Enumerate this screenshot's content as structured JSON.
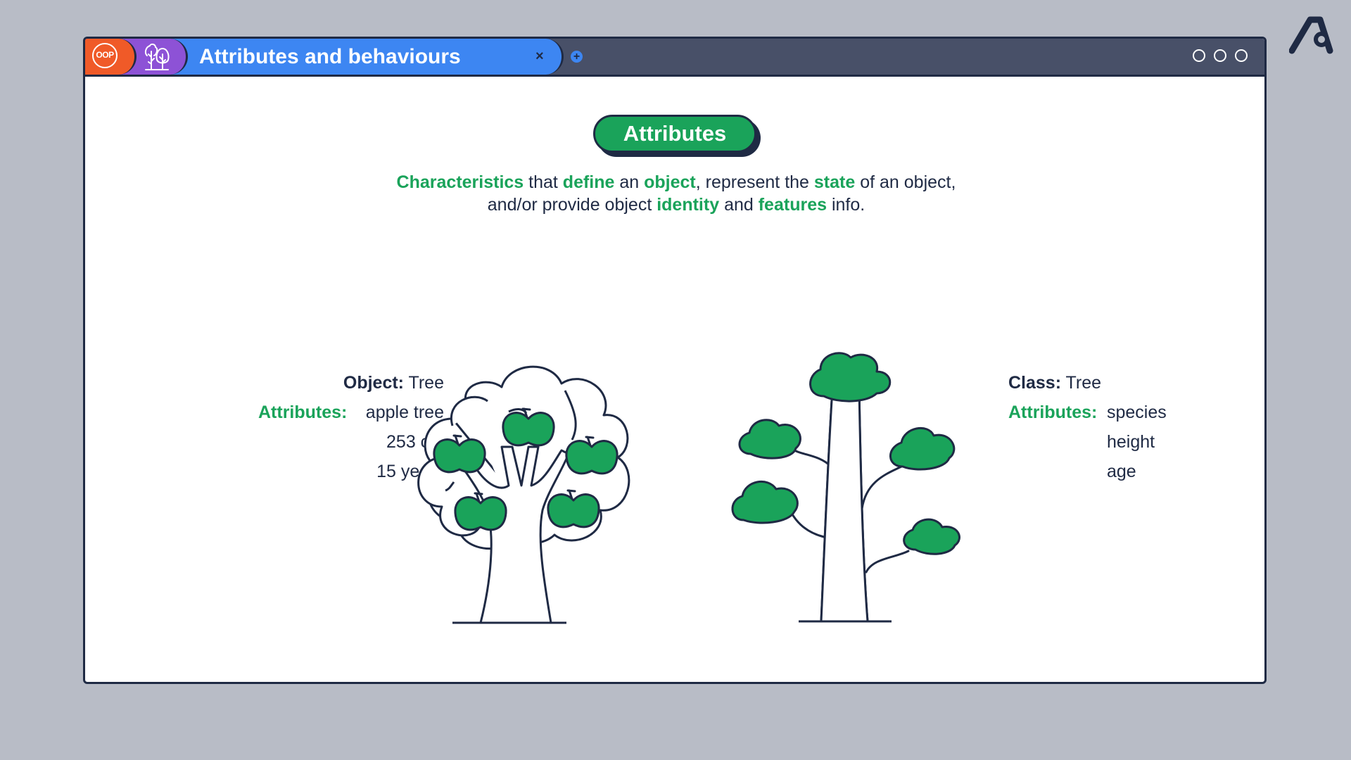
{
  "window": {
    "tab_title": "Attributes and behaviours",
    "tab_close": "×",
    "new_tab": "+",
    "badge_text": "OOP",
    "icons": [
      "oop-badge",
      "trees-icon",
      "close-icon",
      "plus-icon",
      "window-control-circles"
    ]
  },
  "colors": {
    "background": "#b8bcc6",
    "titlebar": "#485068",
    "tab_blue": "#3d86f2",
    "tab_purple": "#8d52d6",
    "tab_orange": "#f05a28",
    "accent_green": "#1aa35a",
    "ink": "#1f2a44"
  },
  "heading": "Attributes",
  "description": {
    "w1": "Characteristics",
    "t1": " that ",
    "w2": "define",
    "t2": " an ",
    "w3": "object",
    "t3": ", represent the ",
    "w4": "state",
    "t4": " of an object, and/or provide object ",
    "w5": "identity",
    "t5": " and ",
    "w6": "features",
    "t6": " info."
  },
  "object_panel": {
    "label": "Object:",
    "name": " Tree",
    "attributes_label": "Attributes:",
    "values": [
      "apple tree",
      "253 cm",
      "15 years"
    ]
  },
  "class_panel": {
    "label": "Class:",
    "name": " Tree",
    "attributes_label": "Attributes:",
    "values": [
      "species",
      "height",
      "age"
    ]
  }
}
